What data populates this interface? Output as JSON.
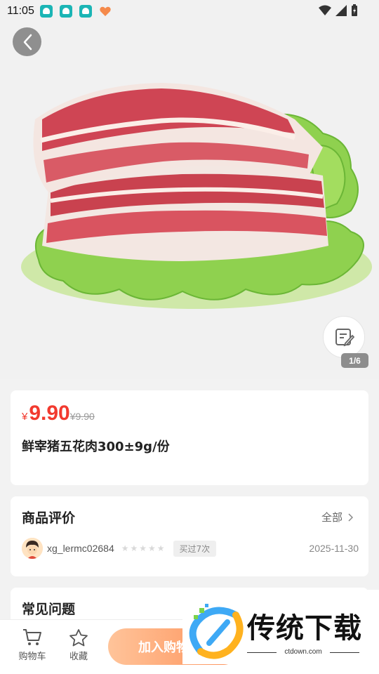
{
  "status_bar": {
    "time": "11:05"
  },
  "gallery": {
    "page_indicator": "1/6",
    "image_alt": "pork-belly-on-lettuce"
  },
  "product": {
    "currency": "¥",
    "price": "9.90",
    "original_price": "¥9.90",
    "title": "鲜宰猪五花肉300±9g/份"
  },
  "reviews": {
    "title": "商品评价",
    "all_label": "全部",
    "items": [
      {
        "username": "xg_lermc02684",
        "stars": "★★★★★",
        "bought_tag": "买过7次",
        "date": "2025-11-30"
      }
    ]
  },
  "faq": {
    "title": "常见问题"
  },
  "bottom_bar": {
    "cart_label": "购物车",
    "favorite_label": "收藏",
    "add_to_cart_label": "加入购物"
  },
  "watermark": {
    "title": "传统下载",
    "url": "ctdown.com"
  },
  "colors": {
    "price_red": "#f23a2f",
    "button_gradient_start": "#ffc49a",
    "button_gradient_end": "#fe8f56",
    "background": "#f2f2f2"
  }
}
